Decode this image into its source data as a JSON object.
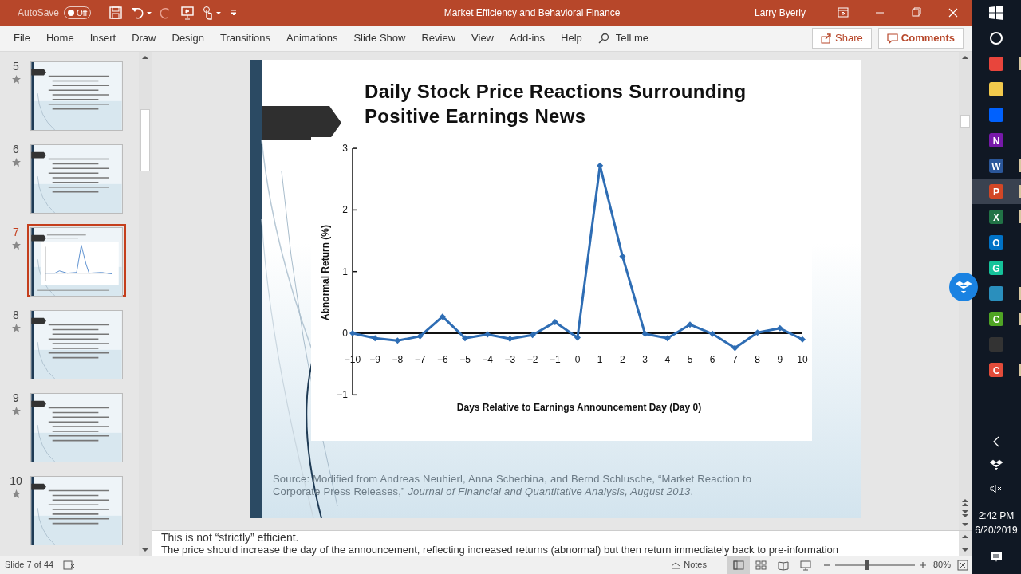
{
  "window": {
    "title": "Market Efficiency and Behavioral Finance",
    "user": "Larry Byerly",
    "autosave": {
      "label": "AutoSave",
      "state": "Off",
      "on": false
    }
  },
  "ribbon": {
    "tabs": [
      "File",
      "Home",
      "Insert",
      "Draw",
      "Design",
      "Transitions",
      "Animations",
      "Slide Show",
      "Review",
      "View",
      "Add-ins",
      "Help"
    ],
    "tell_me": "Tell me",
    "share": "Share",
    "comments": "Comments"
  },
  "thumbnails": [
    {
      "number": "5",
      "kind": "text",
      "selected": false
    },
    {
      "number": "6",
      "kind": "text",
      "selected": false
    },
    {
      "number": "7",
      "kind": "chart",
      "selected": true
    },
    {
      "number": "8",
      "kind": "text",
      "selected": false
    },
    {
      "number": "9",
      "kind": "text",
      "selected": false
    },
    {
      "number": "10",
      "kind": "text",
      "selected": false
    }
  ],
  "slide": {
    "title": "Daily Stock Price Reactions Surrounding Positive Earnings News",
    "chart_data": {
      "type": "line",
      "xlabel": "Days Relative to Earnings Announcement Day (Day 0)",
      "ylabel": "Abnormal Return (%)",
      "x": [
        -10,
        -9,
        -8,
        -7,
        -6,
        -5,
        -4,
        -3,
        -2,
        -1,
        0,
        1,
        2,
        3,
        4,
        5,
        6,
        7,
        8,
        9,
        10
      ],
      "series": [
        {
          "color": "#2e6db4",
          "marker": "diamond",
          "values": [
            0,
            -0.08,
            -0.12,
            -0.05,
            0.27,
            -0.08,
            -0.02,
            -0.09,
            -0.03,
            0.18,
            -0.07,
            2.72,
            1.25,
            -0.01,
            -0.08,
            0.14,
            -0.01,
            -0.24,
            0.01,
            0.08,
            -0.1
          ]
        }
      ],
      "xlim": [
        -10,
        10
      ],
      "ylim": [
        -1,
        3
      ],
      "xticks": [
        {
          "value": -10,
          "label": "−10"
        },
        {
          "value": -9,
          "label": "−9"
        },
        {
          "value": -8,
          "label": "−8"
        },
        {
          "value": -7,
          "label": "−7"
        },
        {
          "value": -6,
          "label": "−6"
        },
        {
          "value": -5,
          "label": "−5"
        },
        {
          "value": -4,
          "label": "−4"
        },
        {
          "value": -3,
          "label": "−3"
        },
        {
          "value": -2,
          "label": "−2"
        },
        {
          "value": -1,
          "label": "−1"
        },
        0,
        1,
        2,
        3,
        4,
        5,
        6,
        7,
        8,
        9,
        10
      ],
      "yticks": [
        {
          "value": -1,
          "label": "−1"
        },
        0,
        1,
        2,
        3
      ]
    },
    "source": "Source: Modified from Andreas Neuhierl, Anna Scherbina, and Bernd Schlusche, “Market Reaction to Corporate Press Releases,” *Journal of Financial and Quantitative Analysis, August 2013*."
  },
  "notes": [
    "This is not “strictly” efficient.",
    "The price should increase the day of the announcement, reflecting increased returns (abnormal) but then return immediately back to pre-information"
  ],
  "status_bar": {
    "slide": "Slide 7 of 44",
    "notes": "Notes",
    "views": [
      {
        "kind": "normal",
        "selected": true
      },
      {
        "kind": "sorter",
        "selected": false
      },
      {
        "kind": "reading",
        "selected": false
      },
      {
        "kind": "show",
        "selected": false
      }
    ],
    "zoom": {
      "level": 0.4,
      "reading": "80%"
    }
  },
  "taskbar": {
    "apps": [
      {
        "kind": "start",
        "selected": false,
        "running": false
      },
      {
        "kind": "search",
        "selected": false,
        "running": false
      },
      {
        "kind": "tile",
        "color": "#e8453c",
        "selected": false,
        "running": true
      },
      {
        "kind": "tile",
        "color": "#f2c94c",
        "selected": false,
        "running": false
      },
      {
        "kind": "tile",
        "color": "#0061fe",
        "selected": false,
        "running": false
      },
      {
        "kind": "tile",
        "color": "#7719aa",
        "glyph": "N",
        "selected": false,
        "running": false
      },
      {
        "kind": "tile",
        "color": "#2b579a",
        "glyph": "W",
        "selected": false,
        "running": true
      },
      {
        "kind": "tile",
        "color": "#d24726",
        "glyph": "P",
        "selected": true,
        "running": true
      },
      {
        "kind": "tile",
        "color": "#217346",
        "glyph": "X",
        "selected": false,
        "running": true
      },
      {
        "kind": "tile",
        "color": "#0072c6",
        "glyph": "O",
        "selected": false,
        "running": false
      },
      {
        "kind": "tile",
        "color": "#15c39a",
        "glyph": "G",
        "selected": false,
        "running": false
      },
      {
        "kind": "tile",
        "color": "#2a8fbd",
        "selected": false,
        "running": true
      },
      {
        "kind": "tile",
        "color": "#4fa524",
        "glyph": "C",
        "selected": false,
        "running": true
      },
      {
        "kind": "tile",
        "color": "#333333",
        "selected": false,
        "running": false
      },
      {
        "kind": "tile",
        "color": "#e34c3a",
        "glyph": "C",
        "selected": false,
        "running": true
      }
    ],
    "time": "2:42 PM",
    "date": "6/20/2019"
  }
}
